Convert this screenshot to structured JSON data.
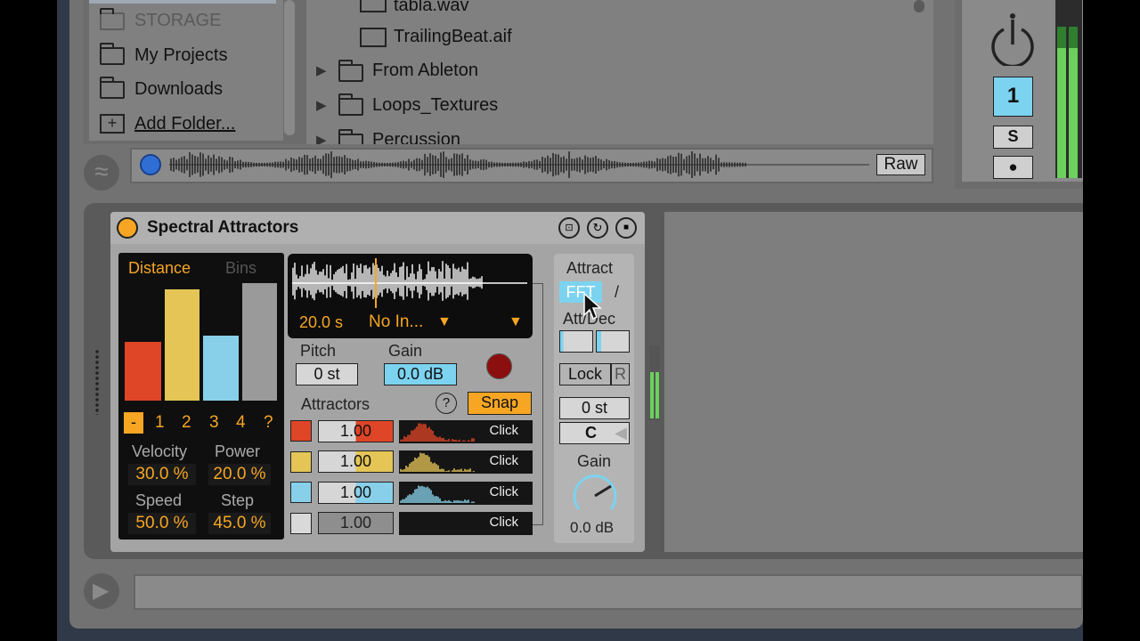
{
  "colors": {
    "accent_orange": "#f6a623",
    "accent_blue": "#88d7f0",
    "bar_red": "#df4527",
    "bar_yellow": "#e4c556",
    "bar_blue": "#88d0ea",
    "bar_gray": "#9a9a9a"
  },
  "browser": {
    "places": [
      {
        "label": "STORAGE",
        "icon": "folder-icon"
      },
      {
        "label": "My Projects",
        "icon": "folder-icon"
      },
      {
        "label": "Downloads",
        "icon": "folder-icon"
      },
      {
        "label": "Add Folder...",
        "icon": "add-folder-icon"
      }
    ],
    "files": [
      {
        "label": "tabla.wav",
        "icon": "audio-file-icon"
      },
      {
        "label": "TrailingBeat.aif",
        "icon": "audio-file-icon"
      },
      {
        "label": "From Ableton",
        "icon": "folder-icon"
      },
      {
        "label": "Loops_Textures",
        "icon": "folder-icon"
      },
      {
        "label": "Percussion",
        "icon": "folder-icon"
      }
    ],
    "raw_label": "Raw"
  },
  "mixer": {
    "track_number": "1",
    "solo_label": "S",
    "arm_symbol": "●"
  },
  "device": {
    "title": "Spectral Attractors",
    "mode_tabs": [
      "Distance",
      "Bins"
    ],
    "bar_levels": [
      0.5,
      0.95,
      0.55,
      1.0
    ],
    "attractor_selectors": [
      "-",
      "1",
      "2",
      "3",
      "4",
      "?"
    ],
    "params": [
      {
        "label": "Velocity",
        "value": "30.0 %"
      },
      {
        "label": "Power",
        "value": "20.0 %"
      },
      {
        "label": "Speed",
        "value": "50.0 %"
      },
      {
        "label": "Step",
        "value": "45.0 %"
      }
    ],
    "sample": {
      "length": "20.0 s",
      "input": "No In..."
    },
    "pitch": {
      "label": "Pitch",
      "value": "0 st"
    },
    "gain": {
      "label": "Gain",
      "value": "0.0 dB"
    },
    "attractors_label": "Attractors",
    "help": "?",
    "snap": "Snap",
    "attractor_rows": [
      {
        "value": "1.00",
        "button": "Click",
        "color": "#df4527"
      },
      {
        "value": "1.00",
        "button": "Click",
        "color": "#e4c556"
      },
      {
        "value": "1.00",
        "button": "Click",
        "color": "#88d0ea"
      },
      {
        "value": "1.00",
        "button": "Click",
        "color": "#d9d9d9"
      }
    ],
    "right": {
      "attract_label": "Attract",
      "fft": "FFT",
      "slash": "/",
      "attdec_label": "Att/Dec",
      "lock": "Lock",
      "r": "R",
      "transpose": "0 st",
      "key": "C",
      "gain_label": "Gain",
      "gain_value": "0.0 dB"
    }
  }
}
